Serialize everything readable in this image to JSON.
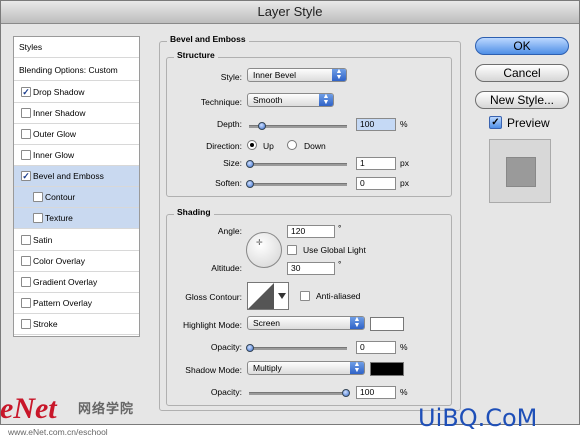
{
  "window": {
    "title": "Layer Style"
  },
  "left_panel": {
    "items": [
      {
        "label": "Styles",
        "checkbox": false,
        "checked": false,
        "selected": false
      },
      {
        "label": "Blending Options: Custom",
        "checkbox": false,
        "checked": false,
        "selected": false
      },
      {
        "label": "Drop Shadow",
        "checkbox": true,
        "checked": true,
        "selected": false
      },
      {
        "label": "Inner Shadow",
        "checkbox": true,
        "checked": false,
        "selected": false
      },
      {
        "label": "Outer Glow",
        "checkbox": true,
        "checked": false,
        "selected": false
      },
      {
        "label": "Inner Glow",
        "checkbox": true,
        "checked": false,
        "selected": false
      },
      {
        "label": "Bevel and Emboss",
        "checkbox": true,
        "checked": true,
        "selected": true
      },
      {
        "label": "Contour",
        "checkbox": true,
        "checked": false,
        "selected": true
      },
      {
        "label": "Texture",
        "checkbox": true,
        "checked": false,
        "selected": true
      },
      {
        "label": "Satin",
        "checkbox": true,
        "checked": false,
        "selected": false
      },
      {
        "label": "Color Overlay",
        "checkbox": true,
        "checked": false,
        "selected": false
      },
      {
        "label": "Gradient Overlay",
        "checkbox": true,
        "checked": false,
        "selected": false
      },
      {
        "label": "Pattern Overlay",
        "checkbox": true,
        "checked": false,
        "selected": false
      },
      {
        "label": "Stroke",
        "checkbox": true,
        "checked": false,
        "selected": false
      }
    ]
  },
  "bevel": {
    "section_title": "Bevel and Emboss",
    "structure_title": "Structure",
    "style_label": "Style:",
    "style_value": "Inner Bevel",
    "technique_label": "Technique:",
    "technique_value": "Smooth",
    "depth_label": "Depth:",
    "depth_value": "100",
    "depth_unit": "%",
    "direction_label": "Direction:",
    "direction_up": "Up",
    "direction_down": "Down",
    "size_label": "Size:",
    "size_value": "1",
    "size_unit": "px",
    "soften_label": "Soften:",
    "soften_value": "0",
    "soften_unit": "px"
  },
  "shading": {
    "title": "Shading",
    "angle_label": "Angle:",
    "angle_value": "120",
    "degree": "°",
    "global_light_label": "Use Global Light",
    "altitude_label": "Altitude:",
    "altitude_value": "30",
    "gloss_label": "Gloss Contour:",
    "anti_aliased_label": "Anti-aliased",
    "highlight_mode_label": "Highlight Mode:",
    "highlight_mode_value": "Screen",
    "highlight_color": "#ffffff",
    "opacity_label": "Opacity:",
    "highlight_opacity": "0",
    "shadow_mode_label": "Shadow Mode:",
    "shadow_mode_value": "Multiply",
    "shadow_color": "#000000",
    "shadow_opacity": "100",
    "percent": "%"
  },
  "buttons": {
    "ok": "OK",
    "cancel": "Cancel",
    "new_style": "New Style...",
    "preview_label": "Preview"
  },
  "watermark": {
    "enet": "eNet",
    "cn": "网络学院",
    "url": "www.eNet.com.cn/eschool",
    "uibq": "UiBQ.CoM"
  }
}
